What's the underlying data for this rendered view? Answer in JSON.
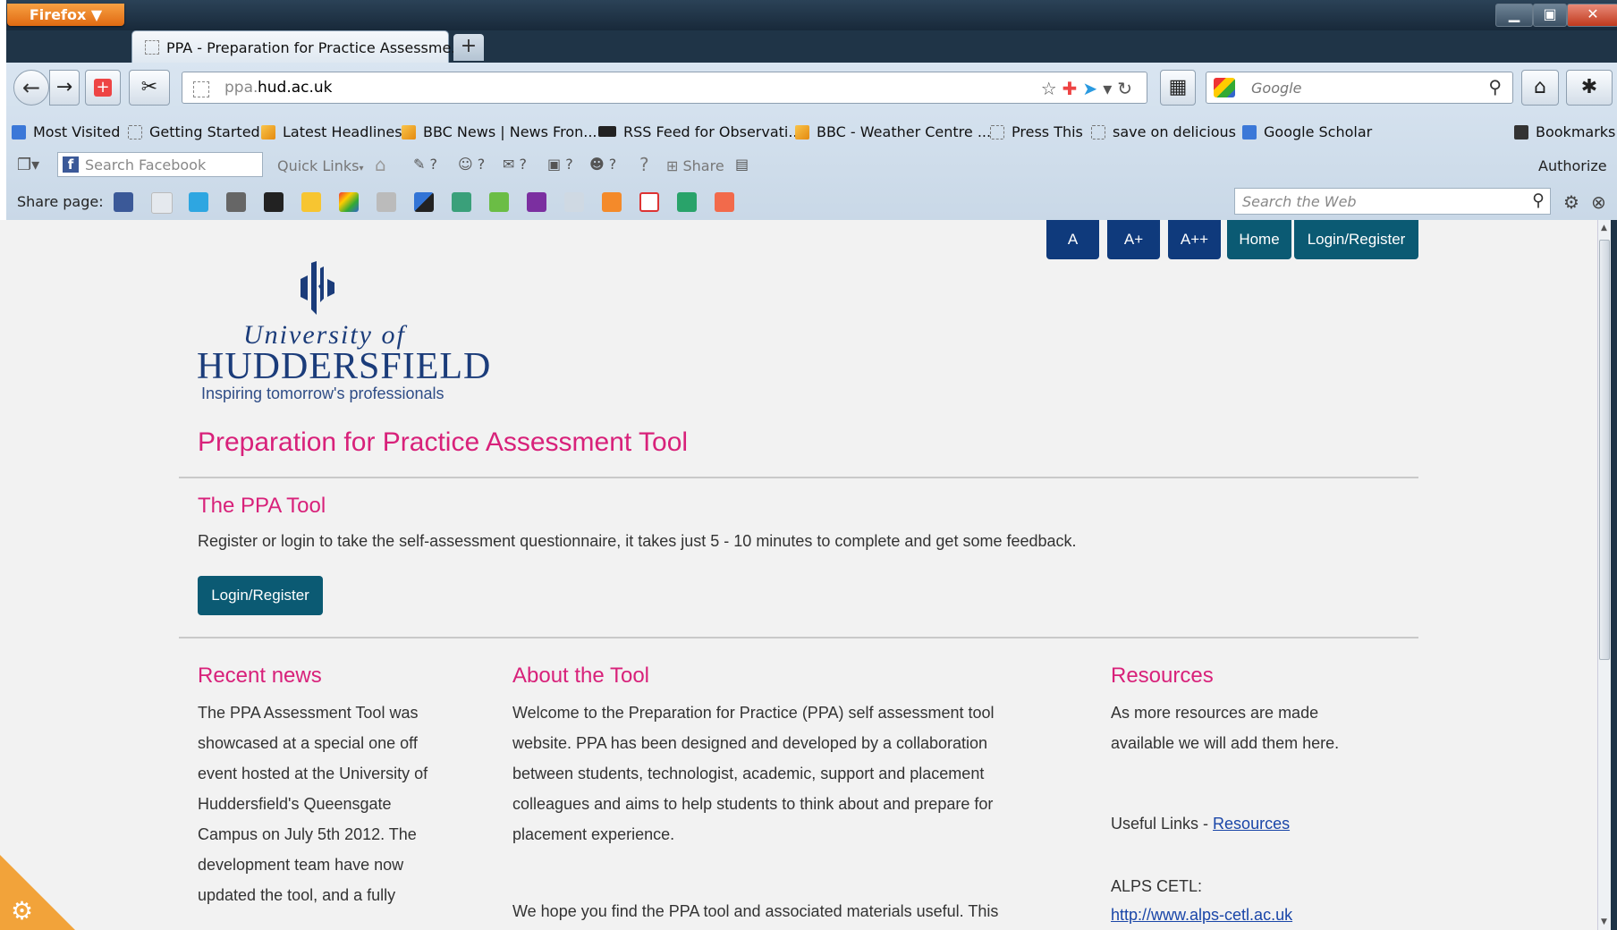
{
  "browser": {
    "menu_button": "Firefox ▼",
    "window_controls": {
      "minimize": "▁",
      "maximize": "▣",
      "close": "✕"
    },
    "tab_title": "PPA - Preparation for Practice Assessme...",
    "new_tab": "+",
    "url": {
      "subdomain": "ppa.",
      "domain": "hud.ac.uk"
    },
    "search_placeholder": "Google",
    "bookmarks": [
      "Most Visited",
      "Getting Started",
      "Latest Headlines",
      "BBC News | News Fron...",
      "RSS Feed for Observati...",
      "BBC - Weather Centre ...",
      "Press This",
      "save on delicious",
      "Google Scholar"
    ],
    "bookmarks_menu": "Bookmarks",
    "facebook": {
      "search_placeholder": "Search Facebook",
      "quick_links": "Quick Links",
      "share": "Share",
      "authorize": "Authorize",
      "badge_q": "?"
    },
    "share_label": "Share page:",
    "web_search_placeholder": "Search the Web"
  },
  "page": {
    "top_buttons": [
      "A",
      "A+",
      "A++",
      "Home",
      "Login/Register"
    ],
    "logo": {
      "line1": "University of",
      "line2": "HUDDERSFIELD",
      "line3": "Inspiring tomorrow's professionals"
    },
    "title": "Preparation for Practice Assessment Tool",
    "section_title": "The PPA Tool",
    "intro": "Register or login to take the self-assessment questionnaire, it takes just 5 - 10 minutes to complete and get some feedback.",
    "cta_button": "Login/Register",
    "recent_news": {
      "title": "Recent news",
      "lines": [
        "The PPA Assessment Tool was",
        "showcased at a special one off",
        "event hosted at the University of",
        "Huddersfield's Queensgate",
        "Campus on July 5th 2012. The",
        "development team have now",
        "updated the tool, and a fully"
      ]
    },
    "about": {
      "title": "About the Tool",
      "lines": [
        "Welcome to the Preparation for Practice (PPA) self assessment tool",
        "website. PPA has been designed and developed by a collaboration",
        "between students, technologist, academic, support and placement",
        "colleagues and aims to help students to think about and prepare for",
        "placement experience."
      ],
      "line2": "We hope you find the PPA tool and associated materials useful. This"
    },
    "resources": {
      "title": "Resources",
      "lines": [
        "As more resources are made",
        "available we will add them here."
      ],
      "useful_label": "Useful Links - ",
      "useful_link": "Resources",
      "alps_label": "ALPS CETL:",
      "alps_link": "http://www.alps-cetl.ac.uk"
    }
  }
}
